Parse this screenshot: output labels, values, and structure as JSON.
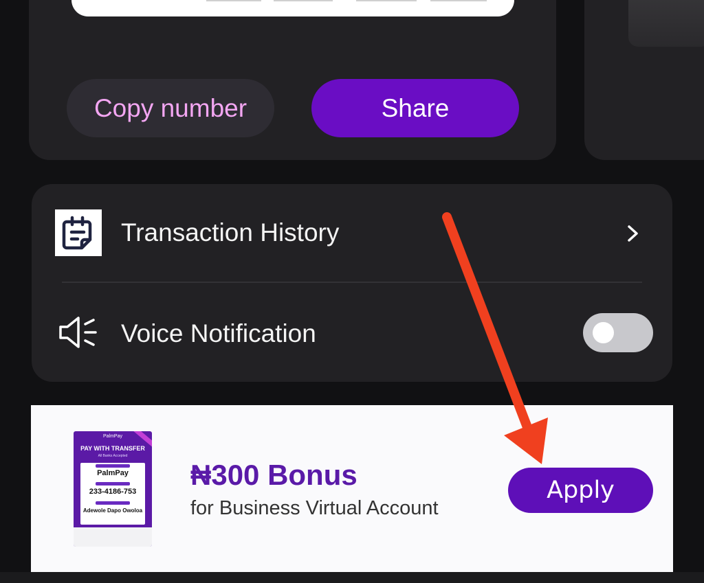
{
  "account_card": {
    "copy_button": "Copy number",
    "share_button": "Share"
  },
  "settings": {
    "transaction_history": {
      "label": "Transaction History",
      "icon": "receipt-icon"
    },
    "voice_notification": {
      "label": "Voice Notification",
      "icon": "speaker-icon",
      "enabled": false
    }
  },
  "promo": {
    "title": "₦300 Bonus",
    "subtitle": "for Business Virtual Account",
    "apply_button": "Apply",
    "poster": {
      "brand": "PalmPay",
      "title": "PAY WITH TRANSFER",
      "subtitle": "All Banks Accepted",
      "bank": "PalmPay",
      "account_number": "233-4186-753",
      "account_name": "Adewole Dapo Owoloa"
    }
  },
  "colors": {
    "background": "#111113",
    "card": "#222124",
    "accent": "#6a0dc4",
    "copy_text": "#f3a6f2",
    "annotation_arrow": "#f0401f"
  }
}
